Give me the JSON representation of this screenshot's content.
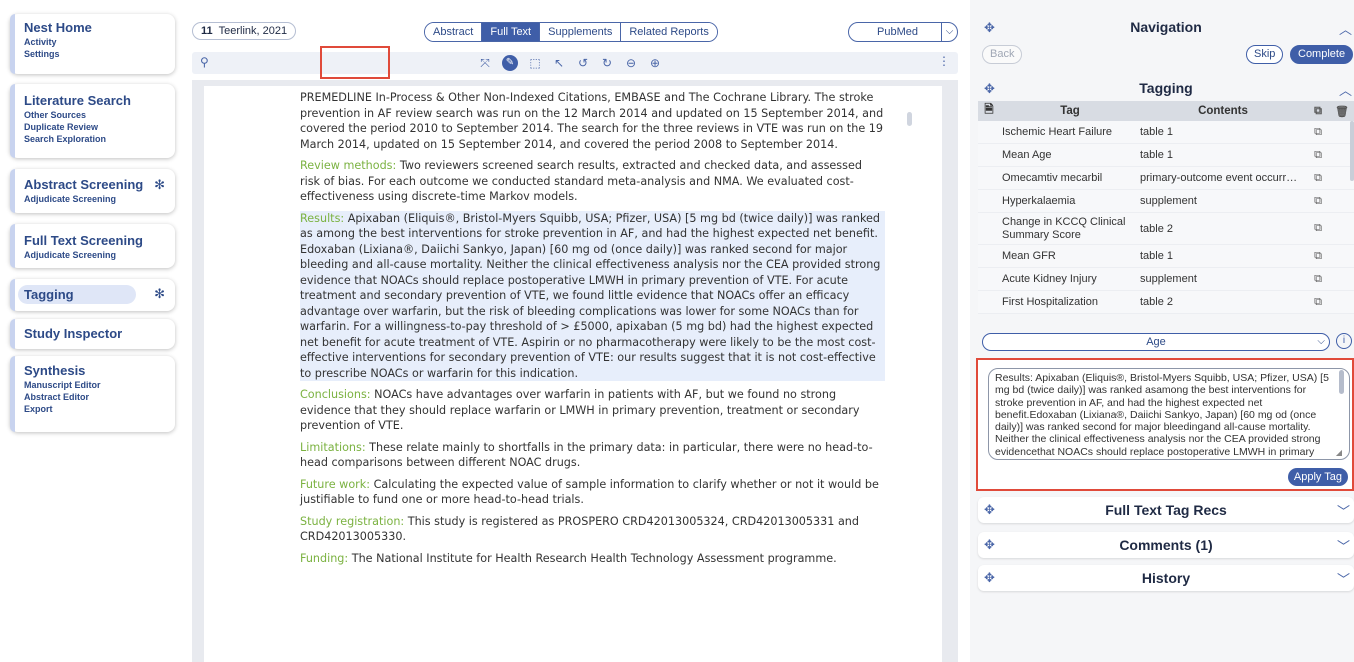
{
  "sidebar": {
    "nest_home": {
      "title": "Nest Home",
      "items": [
        "Activity",
        "Settings"
      ]
    },
    "literature_search": {
      "title": "Literature Search",
      "items": [
        "Other Sources",
        "Duplicate Review",
        "Search Exploration"
      ]
    },
    "abstract_screening": {
      "title": "Abstract Screening",
      "items": [
        "Adjudicate Screening"
      ]
    },
    "full_text_screening": {
      "title": "Full Text Screening",
      "items": [
        "Adjudicate Screening"
      ]
    },
    "tagging": {
      "title": "Tagging"
    },
    "study_inspector": {
      "title": "Study Inspector"
    },
    "synthesis": {
      "title": "Synthesis",
      "items": [
        "Manuscript Editor",
        "Abstract Editor",
        "Export"
      ]
    }
  },
  "header": {
    "study_number": "11",
    "study_name": "Teerlink, 2021",
    "tabs": [
      "Abstract",
      "Full Text",
      "Supplements",
      "Related Reports"
    ],
    "active_tab": "Full Text",
    "source_select": "PubMed"
  },
  "document": {
    "intro": "PREMEDLINE In-Process & Other Non-Indexed Citations, EMBASE and The Cochrane Library. The stroke prevention in AF review search was run on the 12 March 2014 and updated on 15 September 2014, and covered the period 2010 to September 2014. The search for the three reviews in VTE was run on the 19 March 2014, updated on 15 September 2014, and covered the period 2008 to September 2014.",
    "review_methods_label": "Review methods:",
    "review_methods": " Two reviewers screened search results, extracted and checked data, and assessed risk of bias. For each outcome we conducted standard meta-analysis and NMA. We evaluated cost-effectiveness using discrete-time Markov models.",
    "results_label": "Results:",
    "results": " Apixaban (Eliquis®, Bristol-Myers Squibb, USA; Pfizer, USA) [5 mg bd (twice daily)] was ranked as among the best interventions for stroke prevention in AF, and had the highest expected net benefit. Edoxaban (Lixiana®, Daiichi Sankyo, Japan) [60 mg od (once daily)] was ranked second for major bleeding and all-cause mortality. Neither the clinical effectiveness analysis nor the CEA provided strong evidence that NOACs should replace postoperative LMWH in primary prevention of VTE. For acute treatment and secondary prevention of VTE, we found little evidence that NOACs offer an efficacy advantage over warfarin, but the risk of bleeding complications was lower for some NOACs than for warfarin. For a willingness-to-pay threshold of > £5000, apixaban (5 mg bd) had the highest expected net benefit for acute treatment of VTE. Aspirin or no pharmacotherapy were likely to be the most cost-effective interventions for secondary prevention of VTE: our results suggest that it is not cost-effective to prescribe NOACs or warfarin for this indication.",
    "conclusions_label": "Conclusions:",
    "conclusions": " NOACs have advantages over warfarin in patients with AF, but we found no strong evidence that they should replace warfarin or LMWH in primary prevention, treatment or secondary prevention of VTE.",
    "limitations_label": "Limitations:",
    "limitations": " These relate mainly to shortfalls in the primary data: in particular, there were no head-to-head comparisons between different NOAC drugs.",
    "future_work_label": "Future work:",
    "future_work": " Calculating the expected value of sample information to clarify whether or not it would be justifiable to fund one or more head-to-head trials.",
    "registration_label": "Study registration:",
    "registration": " This study is registered as PROSPERO CRD42013005324, CRD42013005331 and CRD42013005330.",
    "funding_label": "Funding:",
    "funding": " The National Institute for Health Research Health Technology Assessment programme."
  },
  "navigation_panel": {
    "title": "Navigation",
    "back": "Back",
    "skip": "Skip",
    "complete": "Complete"
  },
  "tagging_panel": {
    "title": "Tagging",
    "col_tag": "Tag",
    "col_contents": "Contents",
    "rows": [
      {
        "tag": "Ischemic Heart Failure",
        "contents": "table 1"
      },
      {
        "tag": "Mean Age",
        "contents": "table 1"
      },
      {
        "tag": "Omecamtiv mecarbil",
        "contents": "primary-outcome event occurr…"
      },
      {
        "tag": "Hyperkalaemia",
        "contents": "supplement"
      },
      {
        "tag": "Change in KCCQ Clinical Summary Score",
        "contents": "table 2"
      },
      {
        "tag": "Mean GFR",
        "contents": "table 1"
      },
      {
        "tag": "Acute Kidney Injury",
        "contents": "supplement"
      },
      {
        "tag": "First Hospitalization",
        "contents": "table 2"
      }
    ],
    "selected_tag": "Age",
    "textarea_value": "Results: Apixaban (Eliquis®, Bristol-Myers Squibb, USA; Pfizer, USA) [5 mg bd (twice daily)] was ranked asamong the best interventions for stroke prevention in AF, and had the highest expected net benefit.Edoxaban (Lixiana®, Daiichi Sankyo, Japan) [60 mg od (once daily)] was ranked second for major bleedingand all-cause mortality. Neither the clinical effectiveness analysis nor the CEA provided strong evidencethat NOACs should replace postoperative LMWH in primary",
    "apply_label": "Apply Tag"
  },
  "collapsed_sections": {
    "full_text_tag_recs": "Full Text Tag Recs",
    "comments": "Comments (1)",
    "history": "History"
  }
}
